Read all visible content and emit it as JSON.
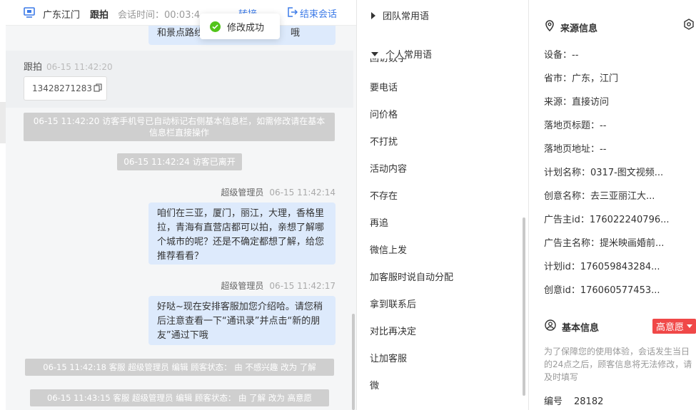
{
  "header": {
    "location": "广东江门",
    "mode": "跟拍",
    "timer_label": "会话时间：00:03:4",
    "hidden_action": "转接",
    "end_label": "结束会话"
  },
  "toast": {
    "text": "修改成功"
  },
  "chat": {
    "partial_top": "和景点路线",
    "partial_top_tail": "哦",
    "agent_name": "跟拍",
    "agent_time": "06-15 11:42:20",
    "phone": "13428271283",
    "sys1": "06-15 11:42:20 访客手机号已自动标记右侧基本信息栏，如需修改请在基本信息栏直接操作",
    "sys2": "06-15 11:42:24 访客已离开",
    "msg1_sender": "超级管理员",
    "msg1_time": "06-15 11:42:14",
    "msg1_text": "咱们在三亚，厦门，丽江，大理，香格里拉，青海有直营店都可以拍，亲想了解哪个城市的呢？还是不确定都想了解，给您推荐看看？",
    "msg2_sender": "超级管理员",
    "msg2_time": "06-15 11:42:17",
    "msg2_text": "好哒~现在安排客服加您介绍哈。请您稍后注意查看一下“通讯录”并点击“新的朋友”通过下哦",
    "sys3": "06-15 11:42:18 客服 超级管理员 编辑 顾客状态： 由 不感兴趣 改为 了解",
    "sys4": "06-15 11:43:15 客服 超级管理员 编辑 顾客状态： 由 了解 改为 高意愿"
  },
  "phrases": {
    "team_group": "团队常用语",
    "personal_group": "个人常用语",
    "partial_item": "回访数字",
    "items": [
      "要电话",
      "问价格",
      "不打扰",
      "活动内容",
      "不存在",
      "再追",
      "微信上发",
      "加客服时说自动分配",
      "拿到联系后",
      "对比再决定",
      "让加客服",
      "微"
    ]
  },
  "info": {
    "source_title": "来源信息",
    "rows": [
      "设备：--",
      "省市：广东，江门",
      "来源：直接访问",
      "落地页标题：--",
      "落地页地址：--",
      "计划名称：0317-图文视频...",
      "创意名称：去三亚丽江大...",
      "广告主id：176022240796...",
      "广告主名称：提米映画婚前...",
      "计划id：176059843284...",
      "创意id：176060577453..."
    ],
    "basic_title": "基本信息",
    "intent_badge": "高意愿",
    "notice": "为了保障您的使用体验，会话发生当日的24点之后，顾客信息将无法修改，请及时填写",
    "serial_label": "编号",
    "serial_value": "28182"
  },
  "colors": {
    "accent": "#3d7be8",
    "bubble": "#ddeafc",
    "system": "#cfcfcf",
    "badge": "#f04848",
    "success": "#52c41a"
  }
}
